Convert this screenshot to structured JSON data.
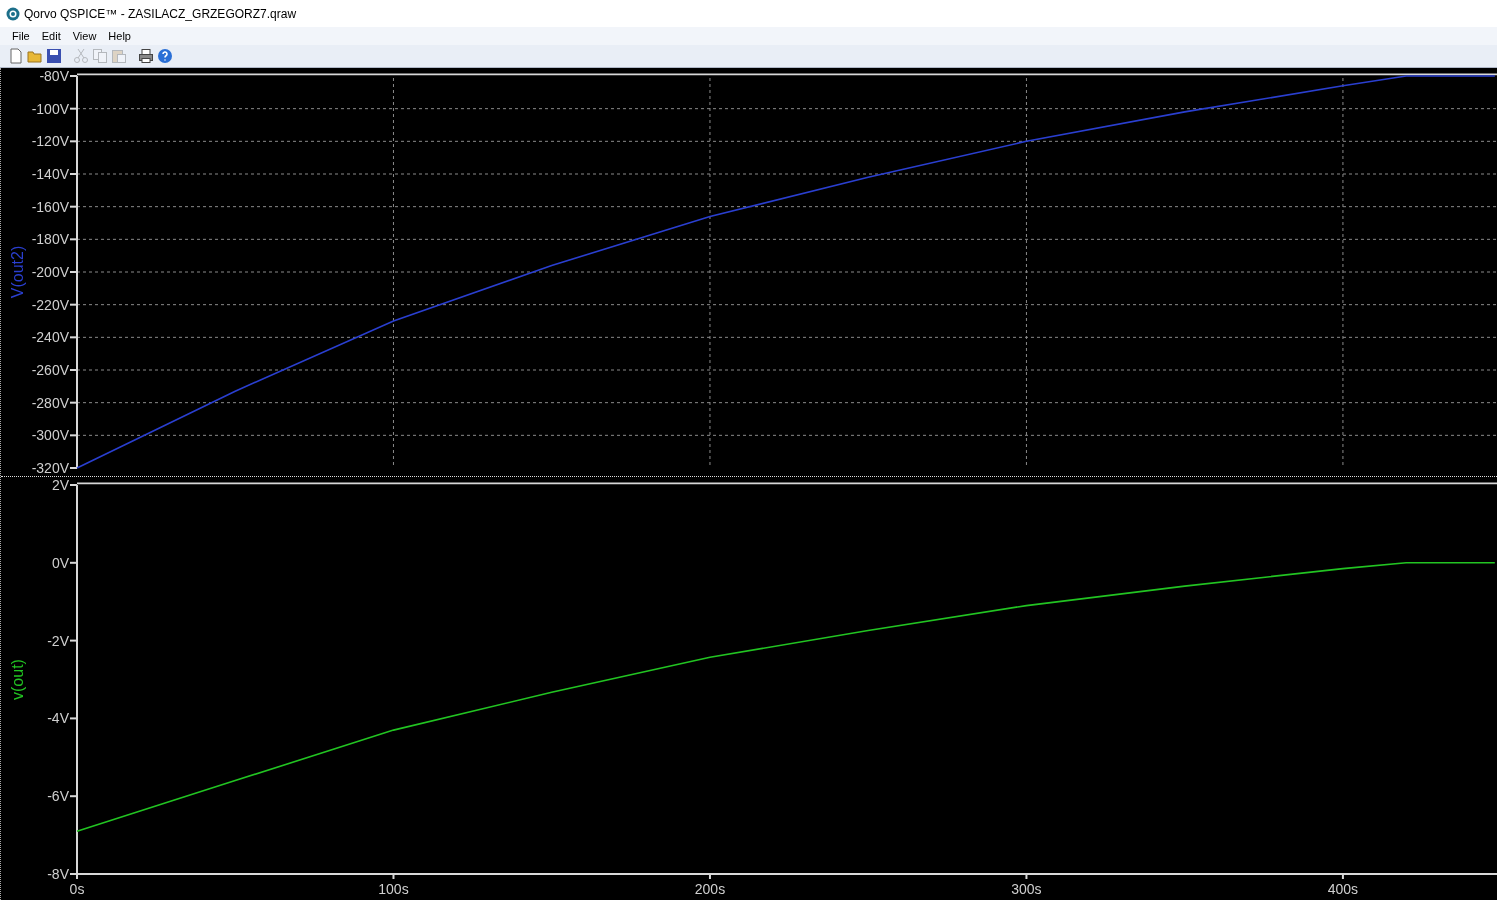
{
  "window": {
    "title": "Qorvo QSPICE™ - ZASILACZ_GRZEGORZ7.qraw"
  },
  "menu": [
    "File",
    "Edit",
    "View",
    "Help"
  ],
  "toolbar": [
    {
      "kind": "new",
      "disabled": false
    },
    {
      "kind": "open",
      "disabled": false
    },
    {
      "kind": "save",
      "disabled": false
    },
    {
      "kind": "cut",
      "disabled": true
    },
    {
      "kind": "copy",
      "disabled": true
    },
    {
      "kind": "paste",
      "disabled": true
    },
    {
      "kind": "print",
      "disabled": false
    },
    {
      "kind": "help",
      "disabled": false
    }
  ],
  "plots": [
    {
      "chart_data": {
        "type": "line",
        "grid": true,
        "x": [
          0,
          50,
          100,
          150,
          200,
          250,
          300,
          350,
          400,
          420,
          448
        ],
        "series": [
          {
            "name": "V(out2)",
            "color": "#2a3fd0",
            "values": [
              -320,
              -273,
              -230,
              -196,
              -166,
              -142,
              -120,
              -102,
              -86,
              -80,
              -80
            ]
          }
        ],
        "xlim": [
          0,
          449
        ],
        "ylim": [
          -320,
          -80
        ],
        "yticks": [
          {
            "value": -80,
            "label": "-80V"
          },
          {
            "value": -100,
            "label": "-100V"
          },
          {
            "value": -120,
            "label": "-120V"
          },
          {
            "value": -140,
            "label": "-140V"
          },
          {
            "value": -160,
            "label": "-160V"
          },
          {
            "value": -180,
            "label": "-180V"
          },
          {
            "value": -200,
            "label": "-200V"
          },
          {
            "value": -220,
            "label": "-220V"
          },
          {
            "value": -240,
            "label": "-240V"
          },
          {
            "value": -260,
            "label": "-260V"
          },
          {
            "value": -280,
            "label": "-280V"
          },
          {
            "value": -300,
            "label": "-300V"
          },
          {
            "value": -320,
            "label": "-320V"
          }
        ]
      }
    },
    {
      "chart_data": {
        "type": "line",
        "grid": false,
        "x": [
          0,
          50,
          100,
          150,
          200,
          250,
          300,
          350,
          400,
          420,
          448
        ],
        "series": [
          {
            "name": "v(out)",
            "color": "#22c422",
            "values": [
              -6.9,
              -5.6,
              -4.3,
              -3.33,
              -2.43,
              -1.74,
              -1.1,
              -0.6,
              -0.15,
              0,
              0
            ]
          }
        ],
        "xlim": [
          0,
          449
        ],
        "ylim": [
          -8,
          2
        ],
        "xticks": [
          {
            "value": 0,
            "label": "0s"
          },
          {
            "value": 100,
            "label": "100s"
          },
          {
            "value": 200,
            "label": "200s"
          },
          {
            "value": 300,
            "label": "300s"
          },
          {
            "value": 400,
            "label": "400s"
          }
        ],
        "yticks": [
          {
            "value": 2,
            "label": "2V"
          },
          {
            "value": 0,
            "label": "0V"
          },
          {
            "value": -2,
            "label": "-2V"
          },
          {
            "value": -4,
            "label": "-4V"
          },
          {
            "value": -6,
            "label": "-6V"
          },
          {
            "value": -8,
            "label": "-8V"
          }
        ]
      }
    }
  ]
}
